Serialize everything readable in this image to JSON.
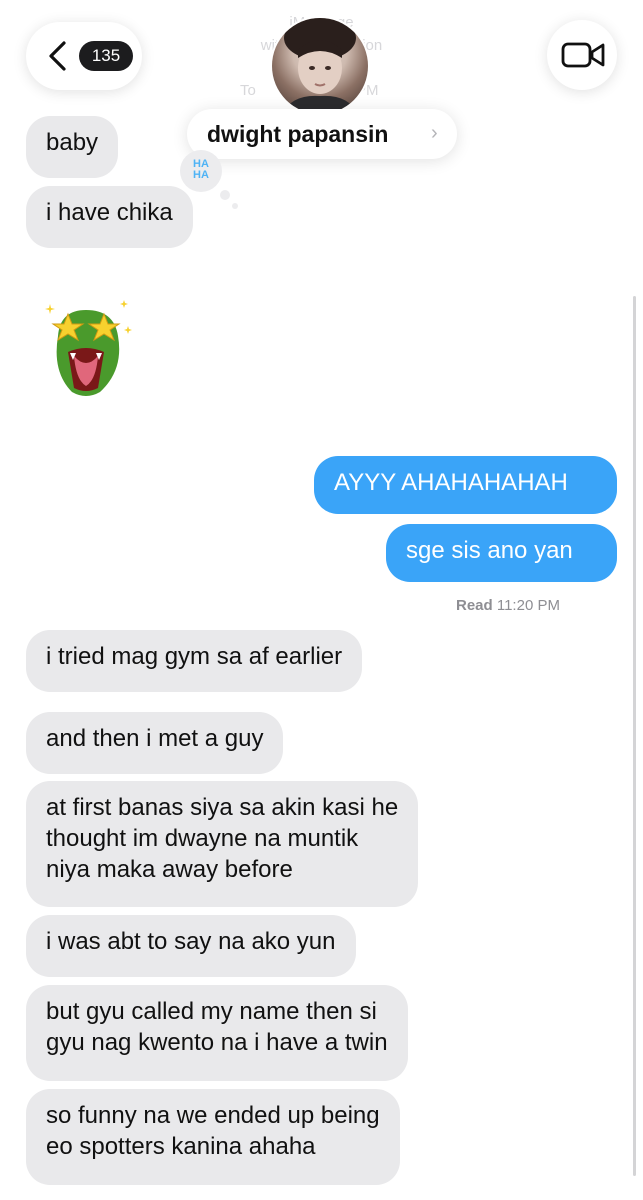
{
  "header": {
    "faded_line1": "iMessage",
    "faded_line2": "with Text Reaction",
    "faded_time_left": "To",
    "faded_time_right": "PM",
    "unread_count": "135",
    "contact_name": "dwight papansin",
    "contact_chevron": "›"
  },
  "messages": [
    {
      "side": "in",
      "text": "baby"
    },
    {
      "side": "in",
      "text": "i have chika"
    },
    {
      "side": "out",
      "text": "AYYY AHAHAHAHAH"
    },
    {
      "side": "out",
      "text": "sge sis ano yan"
    },
    {
      "side": "in",
      "text": "i tried mag gym sa af earlier"
    },
    {
      "side": "in",
      "text": "and then i met a guy"
    },
    {
      "side": "in",
      "text": "at first banas siya sa akin kasi he\nthought im dwayne na muntik\nniya maka away before"
    },
    {
      "side": "in",
      "text": "i was abt to say na ako yun"
    },
    {
      "side": "in",
      "text": "but gyu called my name then si\ngyu nag kwento na i have a twin"
    },
    {
      "side": "in",
      "text": "so funny na we ended up being\neo spotters kanina ahaha"
    }
  ],
  "tapback": {
    "line1": "HA",
    "line2": "HA"
  },
  "read_receipt": {
    "status": "Read",
    "time": "11:20 PM"
  },
  "icons": {
    "back": "chevron-left-icon",
    "video": "video-camera-icon",
    "memoji": "dinosaur-star-eyes-memoji"
  },
  "colors": {
    "incoming": "#e9e9eb",
    "outgoing": "#3aa4f8",
    "badge": "#1c1c1e"
  }
}
